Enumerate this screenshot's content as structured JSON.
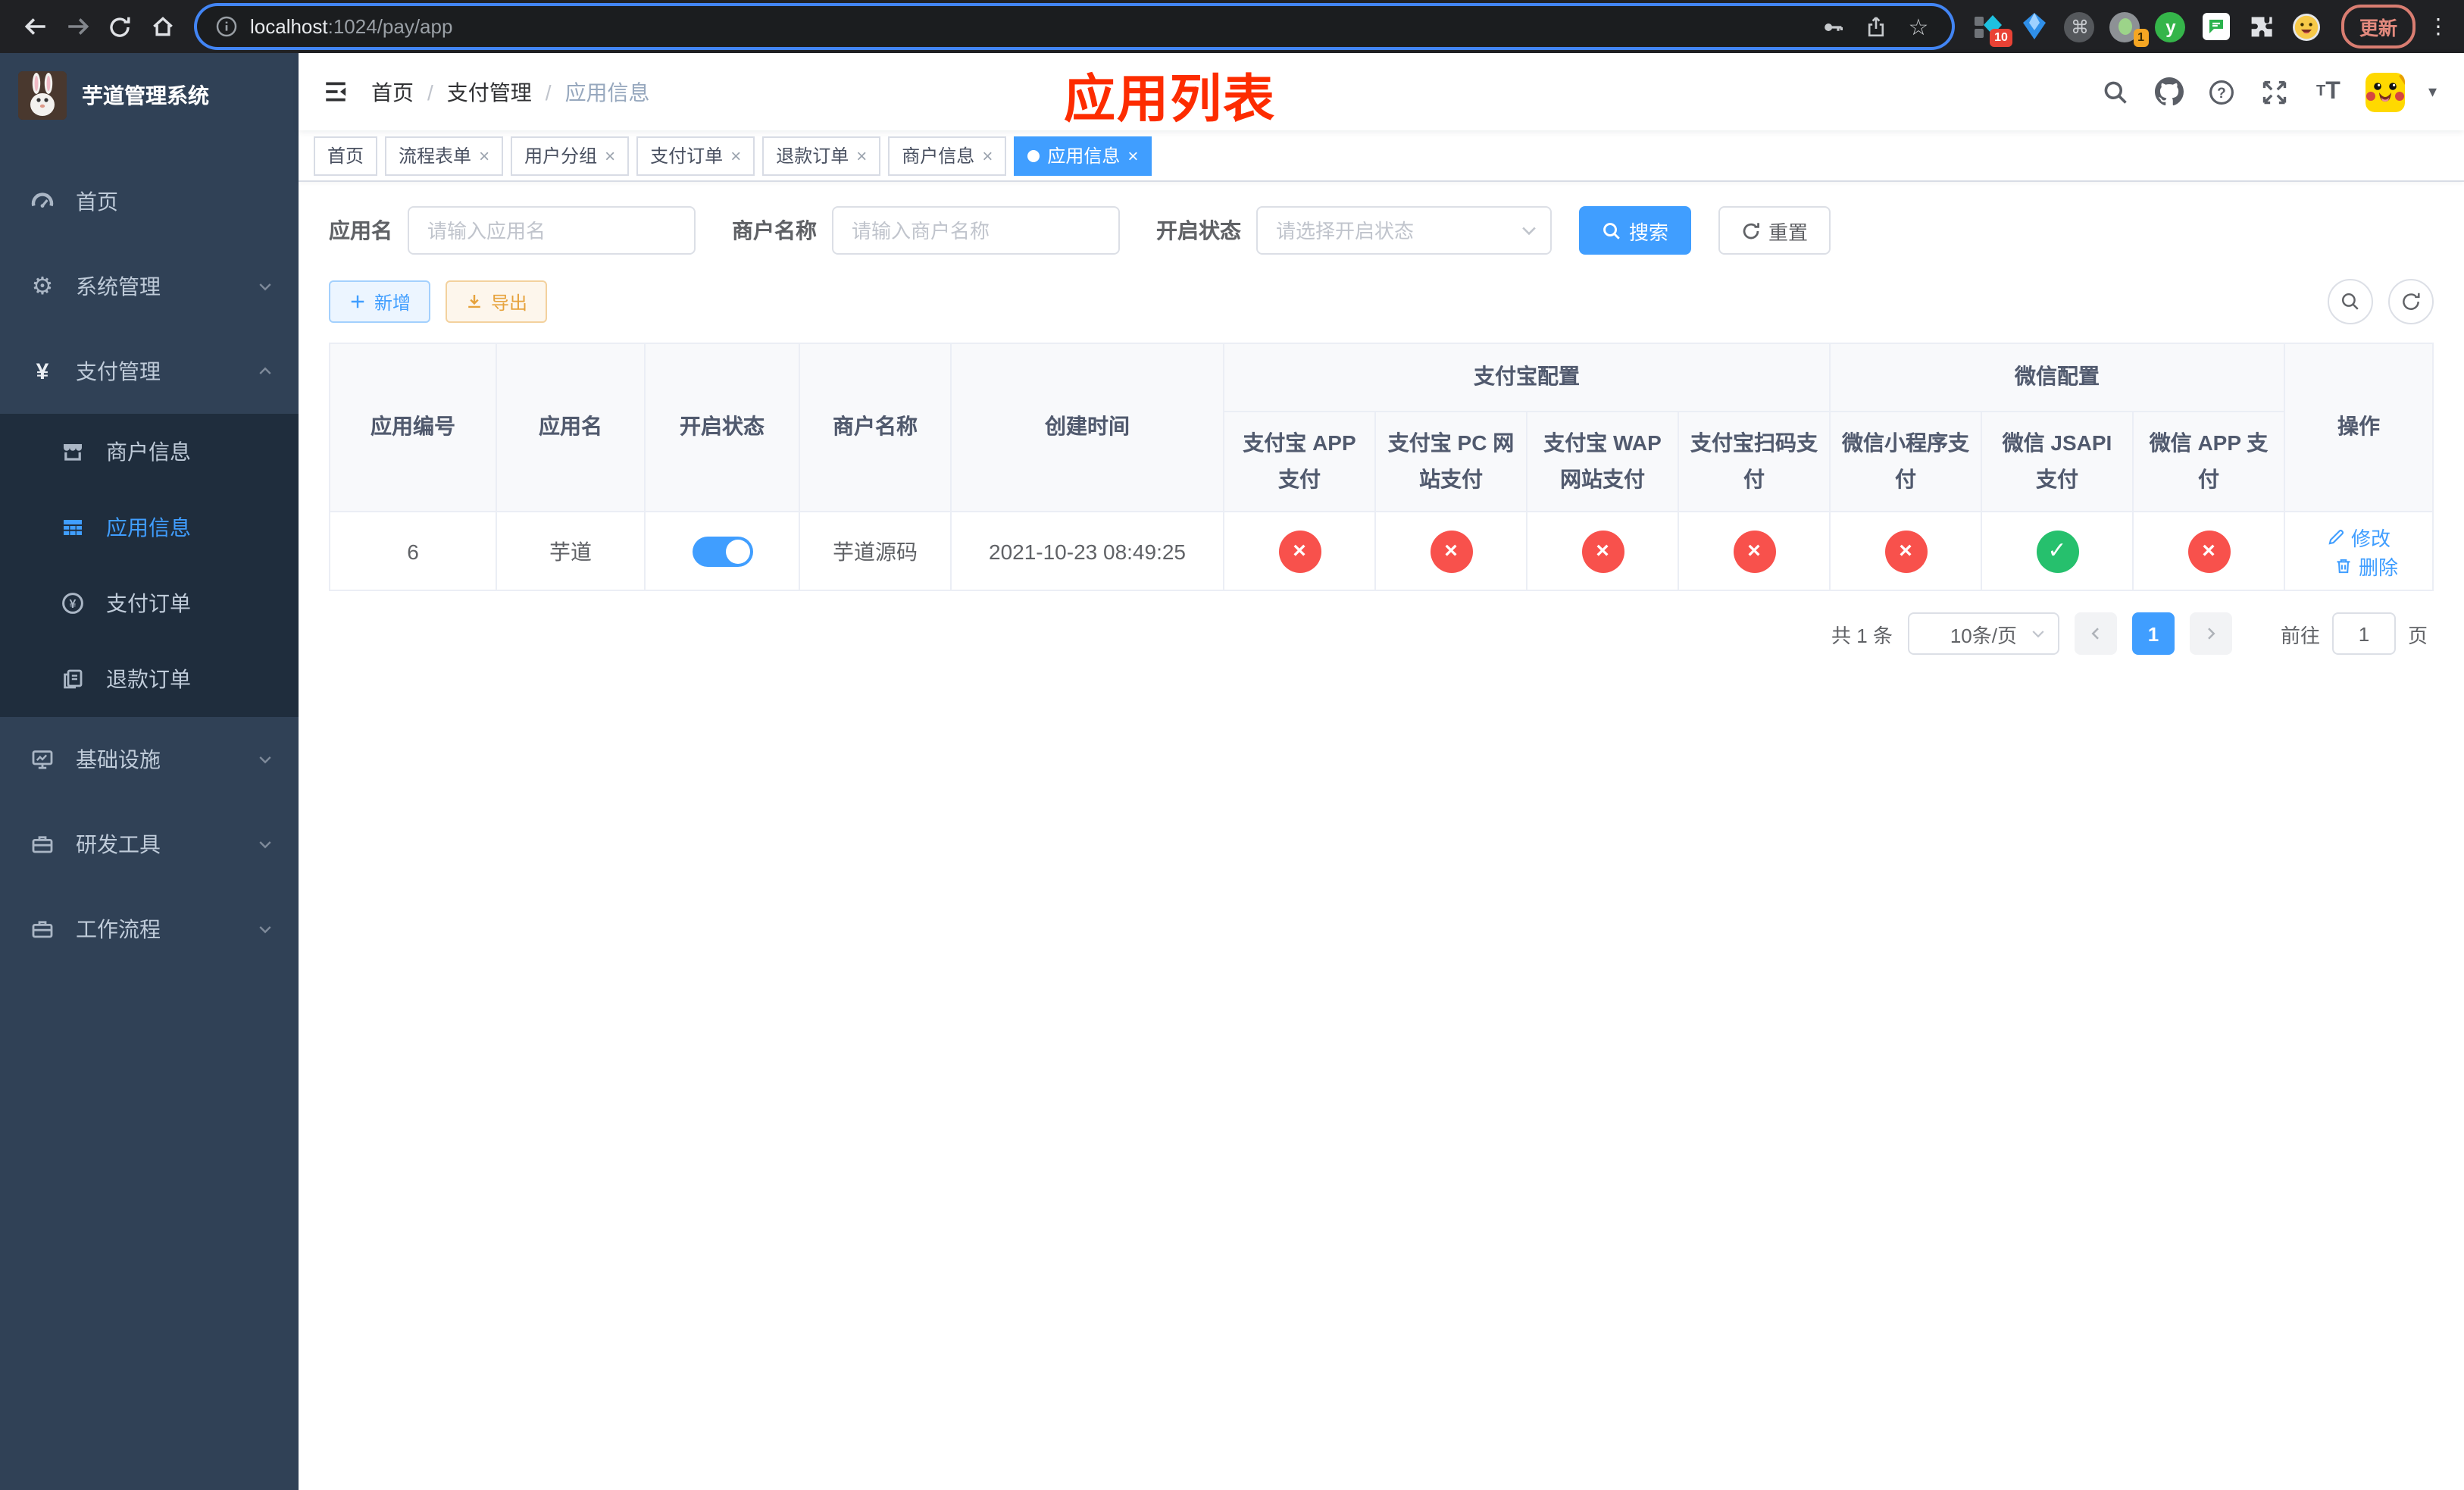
{
  "browser": {
    "url_host": "localhost",
    "url_rest": ":1024/pay/app",
    "update_label": "更新",
    "ext_badge_a": "10",
    "ext_badge_b": "1"
  },
  "sidebar": {
    "title": "芋道管理系统",
    "items": [
      {
        "label": "首页"
      },
      {
        "label": "系统管理"
      },
      {
        "label": "支付管理"
      },
      {
        "label": "商户信息"
      },
      {
        "label": "应用信息"
      },
      {
        "label": "支付订单"
      },
      {
        "label": "退款订单"
      },
      {
        "label": "基础设施"
      },
      {
        "label": "研发工具"
      },
      {
        "label": "工作流程"
      }
    ]
  },
  "navbar": {
    "breadcrumb": [
      "首页",
      "支付管理",
      "应用信息"
    ],
    "separator": "/",
    "overlay_title": "应用列表"
  },
  "tabs": {
    "items": [
      {
        "label": "首页"
      },
      {
        "label": "流程表单"
      },
      {
        "label": "用户分组"
      },
      {
        "label": "支付订单"
      },
      {
        "label": "退款订单"
      },
      {
        "label": "商户信息"
      },
      {
        "label": "应用信息"
      }
    ]
  },
  "filters": {
    "app_name_label": "应用名",
    "app_name_placeholder": "请输入应用名",
    "merchant_label": "商户名称",
    "merchant_placeholder": "请输入商户名称",
    "status_label": "开启状态",
    "status_placeholder": "请选择开启状态",
    "search_label": "搜索",
    "reset_label": "重置"
  },
  "toolbar": {
    "add_label": "新增",
    "export_label": "导出"
  },
  "table": {
    "columns": [
      "应用编号",
      "应用名",
      "开启状态",
      "商户名称",
      "创建时间"
    ],
    "group_alipay": "支付宝配置",
    "group_wechat": "微信配置",
    "sub_columns": [
      "支付宝 APP 支付",
      "支付宝 PC 网站支付",
      "支付宝 WAP 网站支付",
      "支付宝扫码支付",
      "微信小程序支付",
      "微信 JSAPI 支付",
      "微信 APP 支付"
    ],
    "action_column": "操作",
    "row": {
      "id": "6",
      "name": "芋道",
      "status_on": true,
      "merchant": "芋道源码",
      "created": "2021-10-23 08:49:25",
      "configs": [
        "no",
        "no",
        "no",
        "no",
        "no",
        "yes",
        "no"
      ],
      "edit_label": "修改",
      "delete_label": "删除"
    }
  },
  "pagination": {
    "total": "共 1 条",
    "page_size": "10条/页",
    "page": "1",
    "goto_label": "前往",
    "goto_value": "1",
    "goto_unit": "页"
  },
  "colors": {
    "accent": "#409eff",
    "success": "#26c06d",
    "danger": "#f8514c",
    "warning": "#e6a23c",
    "annotation_red": "#fd2c00",
    "sidebar_bg": "#304156",
    "submenu_bg": "#1f2d3d"
  }
}
